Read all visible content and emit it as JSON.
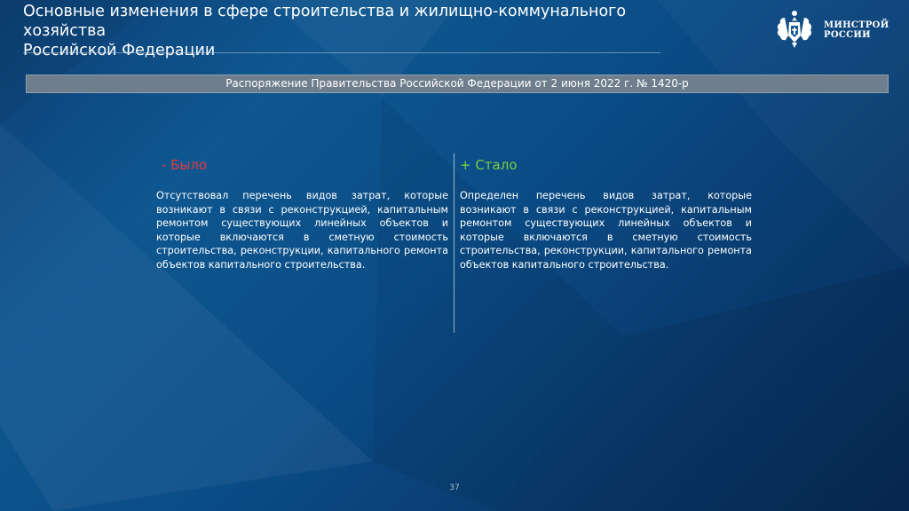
{
  "slide": {
    "title": "Основные изменения в сфере строительства и жилищно-коммунального хозяйства Российской Федерации",
    "title_lines": [
      "Основные изменения в сфере строительства и жилищно-коммунального",
      "хозяйства",
      "Российской Федерации"
    ],
    "decree": "Распоряжение Правительства Российской Федерации от 2 июня 2022 г. № 1420-р",
    "page_number": "37"
  },
  "logo": {
    "line1": "МИНСТРОЙ",
    "line2": "РОССИИ",
    "icon": "double-headed-eagle-emblem"
  },
  "comparison": {
    "was": {
      "heading": "- Было",
      "text": "Отсутствовал перечень видов затрат, которые возникают в связи с реконструкцией, капитальным ремонтом существующих линейных объектов и которые включаются в сметную стоимость строительства, реконструкции, капитального ремонта объектов капитального строительства."
    },
    "now": {
      "heading": "+ Стало",
      "text": " Определен перечень видов затрат, которые возникают в связи с реконструкцией, капитальным ремонтом существующих линейных объектов и которые включаются в сметную стоимость строительства, реконструкции, капитального ремонта объектов капитального строительства."
    }
  },
  "colors": {
    "was_heading": "#e23a3f",
    "now_heading": "#7fcd43",
    "decree_bar": "#6e7e8d"
  }
}
